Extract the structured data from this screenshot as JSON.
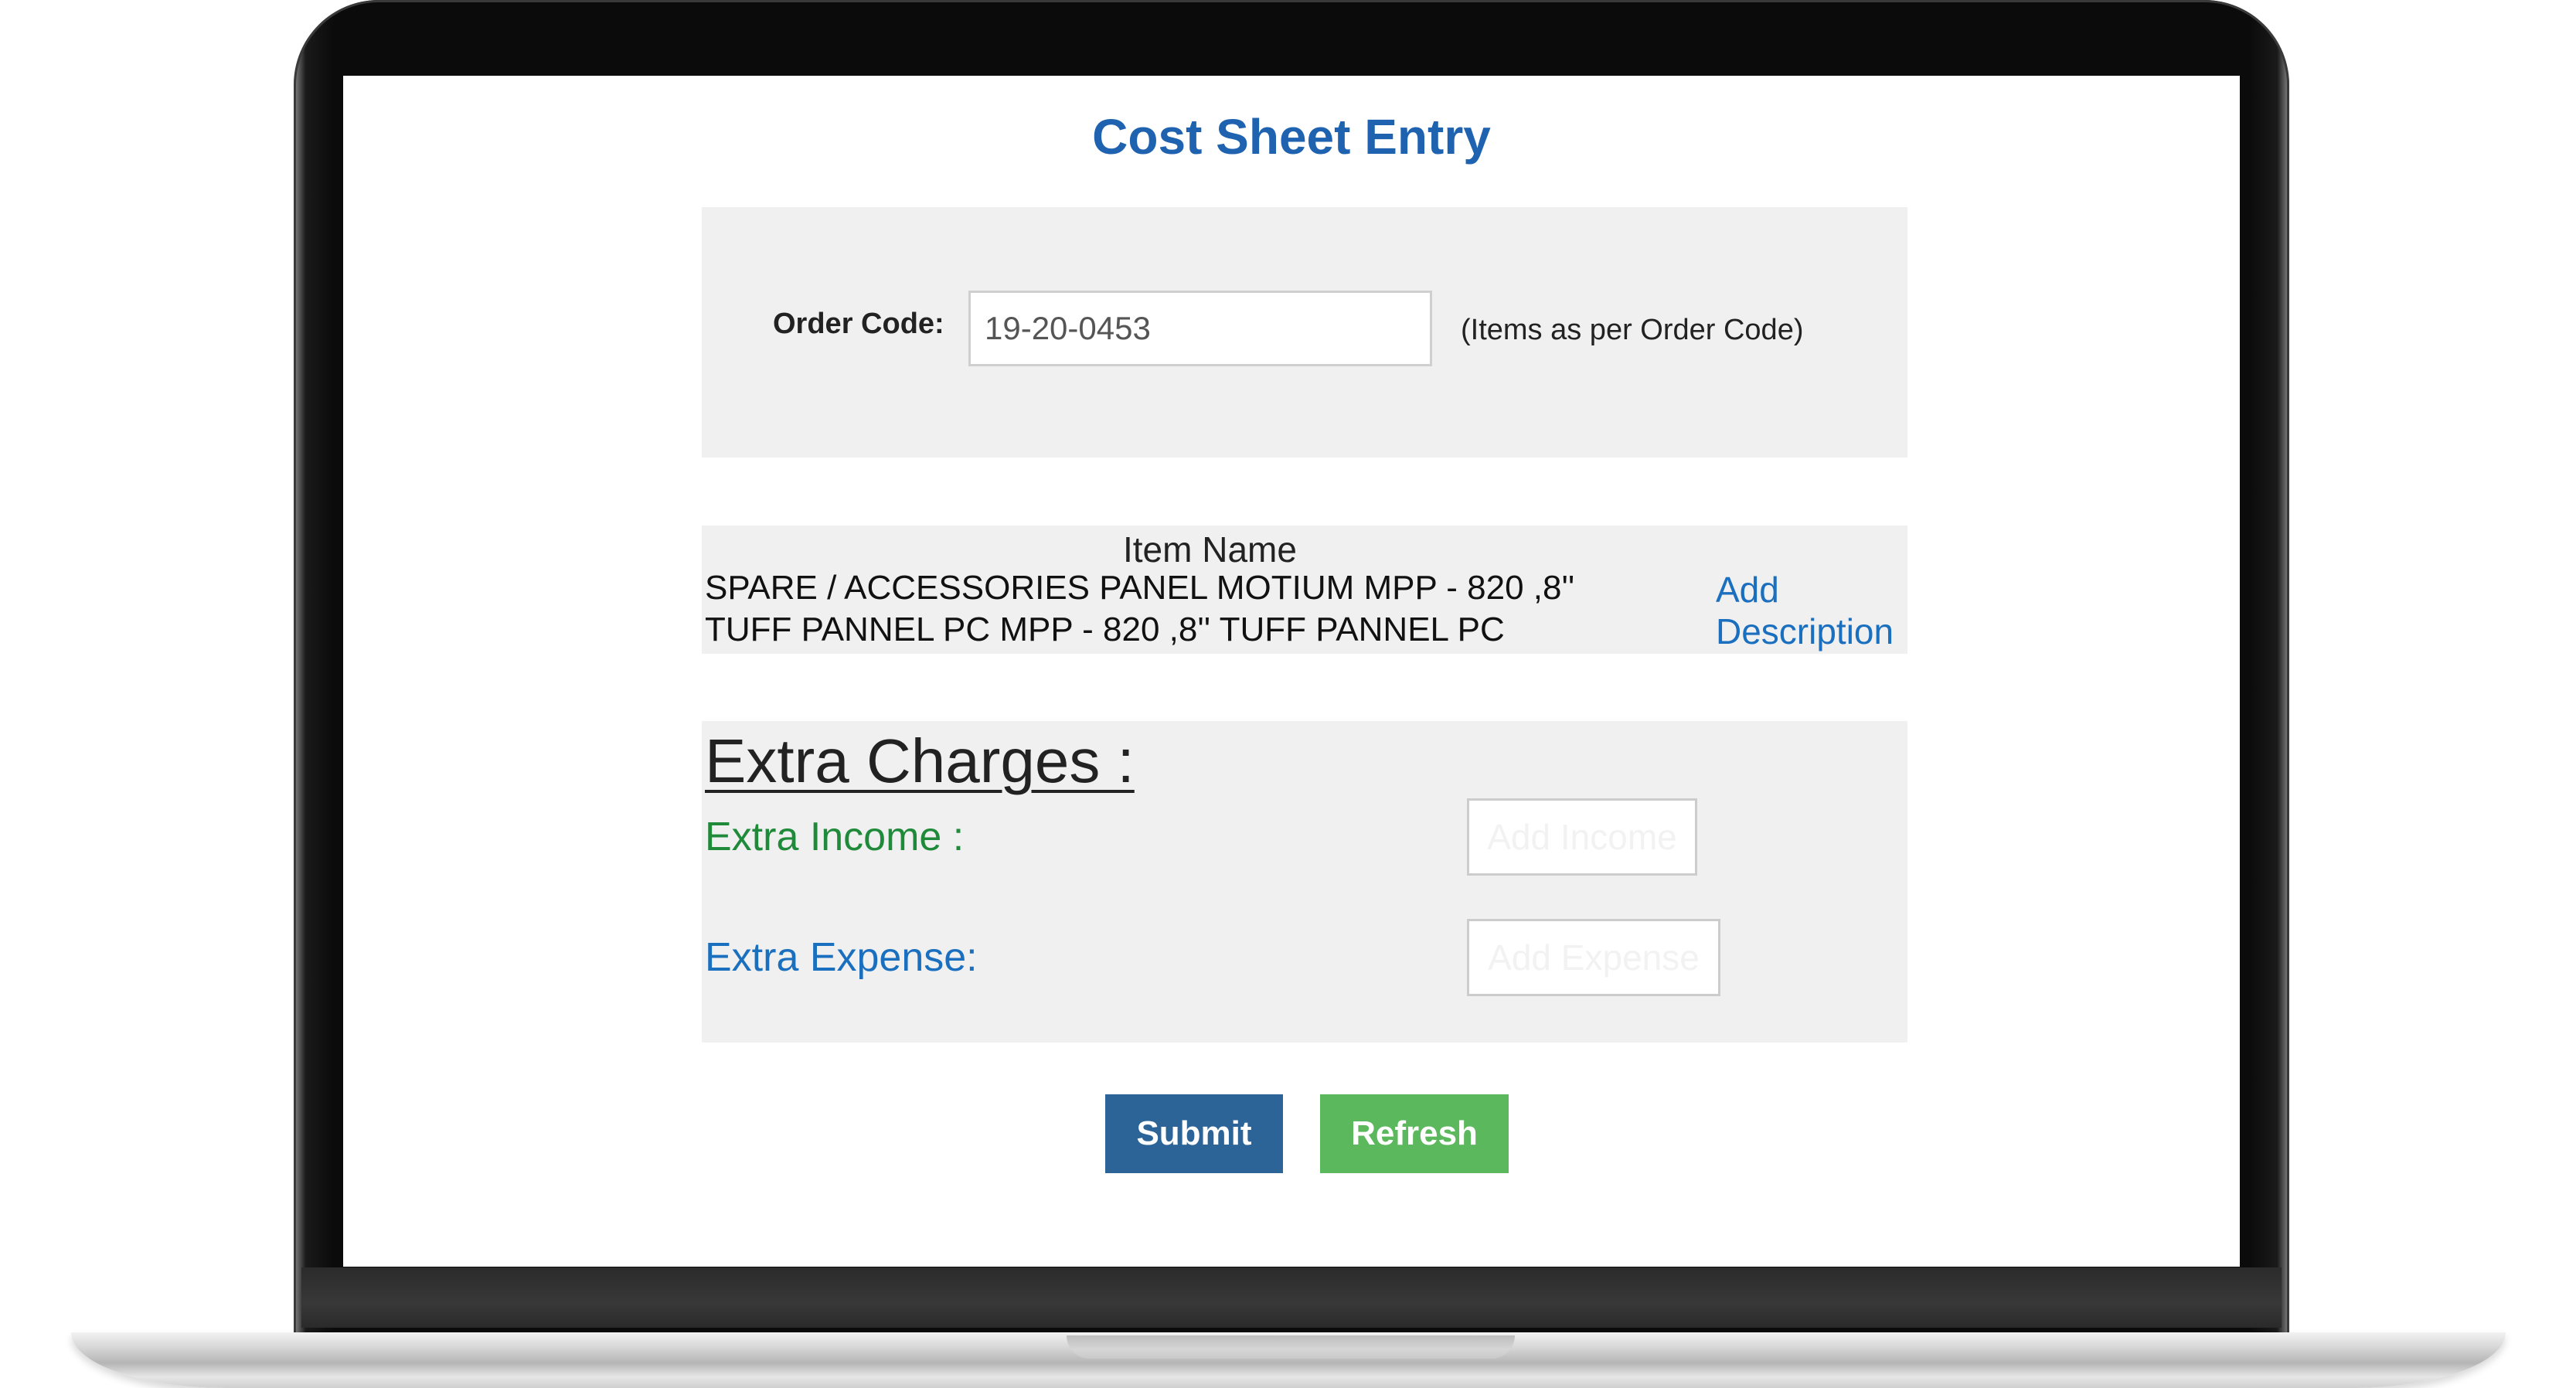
{
  "page": {
    "title": "Cost Sheet Entry"
  },
  "order": {
    "label": "Order Code:",
    "value": "19-20-0453",
    "hint": "(Items as per Order Code)"
  },
  "items": {
    "header": "Item Name",
    "lines": [
      "SPARE / ACCESSORIES PANEL MOTIUM MPP - 820 ,8''",
      "TUFF PANNEL PC MPP - 820 ,8'' TUFF PANNEL PC"
    ],
    "add_description_label": "Add Description"
  },
  "extra": {
    "title": "Extra Charges :",
    "income_label": "Extra Income :",
    "expense_label": "Extra Expense:",
    "add_income_label": "Add Income",
    "add_expense_label": "Add Expense"
  },
  "actions": {
    "submit_label": "Submit",
    "refresh_label": "Refresh"
  },
  "colors": {
    "title": "#1e62b0",
    "income": "#1f8a3a",
    "expense": "#1b6fbf",
    "submit": "#2d6498",
    "refresh": "#5cb85c"
  }
}
